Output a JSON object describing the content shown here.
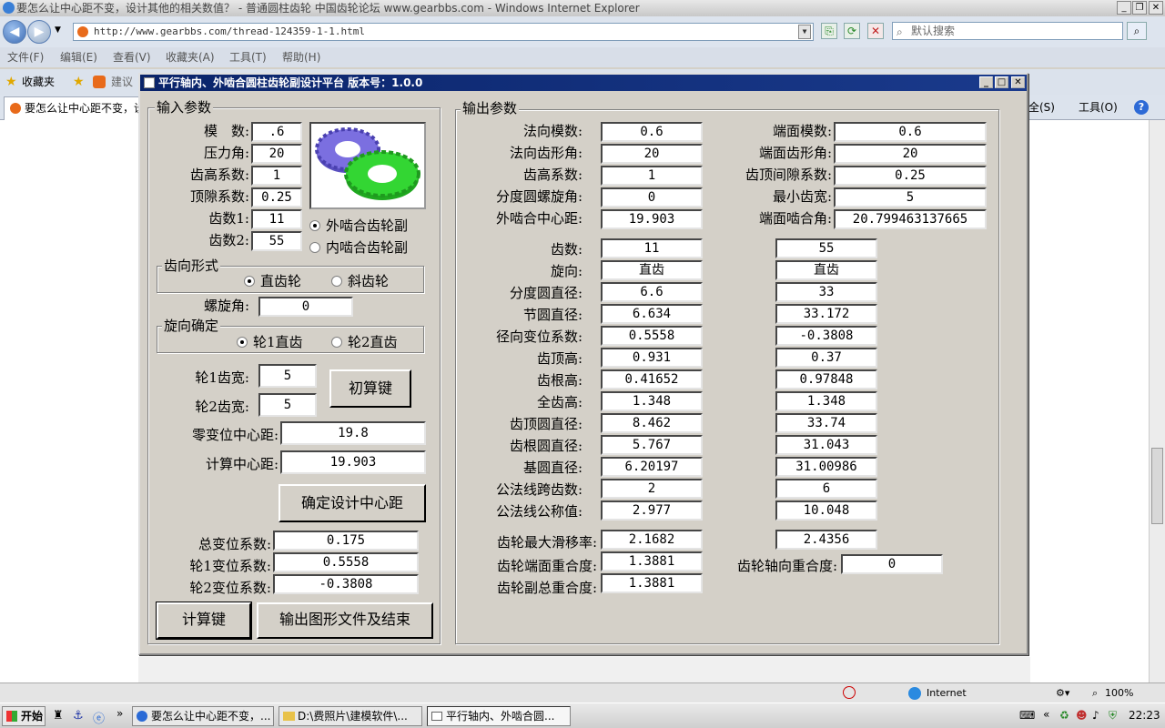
{
  "browser": {
    "title": "要怎么让中心距不变，设计其他的相关数值？ - 普通圆柱齿轮 中国齿轮论坛 www.gearbbs.com - Windows Internet Explorer",
    "url": "http://www.gearbbs.com/thread-124359-1-1.html",
    "search_placeholder": "默认搜索",
    "menu": [
      "文件(F)",
      "编辑(E)",
      "查看(V)",
      "收藏夹(A)",
      "工具(T)",
      "帮助(H)"
    ],
    "fav_label": "收藏夹",
    "fav_suggest": "建议",
    "tab_label": "要怎么让中心距不变，设",
    "cmd_right_1": "全(S)",
    "cmd_right_2": "工具(O)",
    "status_zone": "Internet",
    "zoom": "100%"
  },
  "taskbar": {
    "start": "开始",
    "items": [
      "要怎么让中心距不变，...",
      "D:\\费照片\\建模软件\\...",
      "平行轴内、外啮合圆..."
    ],
    "clock": "22:23"
  },
  "dialog": {
    "title": "平行轴内、外啮合圆柱齿轮副设计平台  版本号：1.0.0",
    "input": {
      "group_title": "输入参数",
      "module_label": "模　数:",
      "module_value": ".6",
      "pressure_label": "压力角:",
      "pressure_value": "20",
      "addendum_label": "齿高系数:",
      "addendum_value": "1",
      "clearance_label": "顶隙系数:",
      "clearance_value": "0.25",
      "z1_label": "齿数1:",
      "z1_value": "11",
      "z2_label": "齿数2:",
      "z2_value": "55",
      "mesh_external": "外啮合齿轮副",
      "mesh_internal": "内啮合齿轮副",
      "tooth_form_title": "齿向形式",
      "spur": "直齿轮",
      "helical": "斜齿轮",
      "helix_label": "螺旋角:",
      "helix_value": "0",
      "hand_title": "旋向确定",
      "hand_1": "轮1直齿",
      "hand_2": "轮2直齿",
      "width1_label": "轮1齿宽:",
      "width1_value": "5",
      "width2_label": "轮2齿宽:",
      "width2_value": "5",
      "initial_calc_button": "初算键",
      "zero_center_label": "零变位中心距:",
      "zero_center_value": "19.8",
      "calc_center_label": "计算中心距:",
      "calc_center_value": "19.903",
      "confirm_center_button": "确定设计中心距",
      "total_shift_label": "总变位系数:",
      "total_shift_value": "0.175",
      "shift1_label": "轮1变位系数:",
      "shift1_value": "0.5558",
      "shift2_label": "轮2变位系数:",
      "shift2_value": "-0.3808",
      "calc_button": "计算键",
      "output_button": "输出图形文件及结束"
    },
    "output": {
      "group_title": "输出参数",
      "normal_module_label": "法向模数:",
      "normal_module_value": "0.6",
      "transverse_module_label": "端面模数:",
      "transverse_module_value": "0.6",
      "normal_pressure_label": "法向齿形角:",
      "normal_pressure_value": "20",
      "transverse_pressure_label": "端面齿形角:",
      "transverse_pressure_value": "20",
      "addendum_coef_label": "齿高系数:",
      "addendum_coef_value": "1",
      "tip_clearance_label": "齿顶间隙系数:",
      "tip_clearance_value": "0.25",
      "helix_angle_label": "分度圆螺旋角:",
      "helix_angle_value": "0",
      "min_width_label": "最小齿宽:",
      "min_width_value": "5",
      "ext_center_label": "外啮合中心距:",
      "ext_center_value": "19.903",
      "transverse_mesh_label": "端面啮合角:",
      "transverse_mesh_value": "20.799463137665",
      "rows": [
        {
          "label": "齿数:",
          "g1": "11",
          "g2": "55"
        },
        {
          "label": "旋向:",
          "g1": "直齿",
          "g2": "直齿"
        },
        {
          "label": "分度圆直径:",
          "g1": "6.6",
          "g2": "33"
        },
        {
          "label": "节圆直径:",
          "g1": "6.634",
          "g2": "33.172"
        },
        {
          "label": "径向变位系数:",
          "g1": "0.5558",
          "g2": "-0.3808"
        },
        {
          "label": "齿顶高:",
          "g1": "0.931",
          "g2": "0.37"
        },
        {
          "label": "齿根高:",
          "g1": "0.41652",
          "g2": "0.97848"
        },
        {
          "label": "全齿高:",
          "g1": "1.348",
          "g2": "1.348"
        },
        {
          "label": "齿顶圆直径:",
          "g1": "8.462",
          "g2": "33.74"
        },
        {
          "label": "齿根圆直径:",
          "g1": "5.767",
          "g2": "31.043"
        },
        {
          "label": "基圆直径:",
          "g1": "6.20197",
          "g2": "31.00986"
        },
        {
          "label": "公法线跨齿数:",
          "g1": "2",
          "g2": "6"
        },
        {
          "label": "公法线公称值:",
          "g1": "2.977",
          "g2": "10.048"
        }
      ],
      "max_slip_label": "齿轮最大滑移率:",
      "max_slip_g1": "2.1682",
      "max_slip_g2": "2.4356",
      "transverse_contact_label": "齿轮端面重合度:",
      "transverse_contact_value": "1.3881",
      "axial_contact_label": "齿轮轴向重合度:",
      "axial_contact_value": "0",
      "total_contact_label": "齿轮副总重合度:",
      "total_contact_value": "1.3881"
    }
  },
  "colors": {
    "gear_purple": "#7b6fe0",
    "gear_green": "#33d633",
    "title_bar": "#0a246a"
  }
}
